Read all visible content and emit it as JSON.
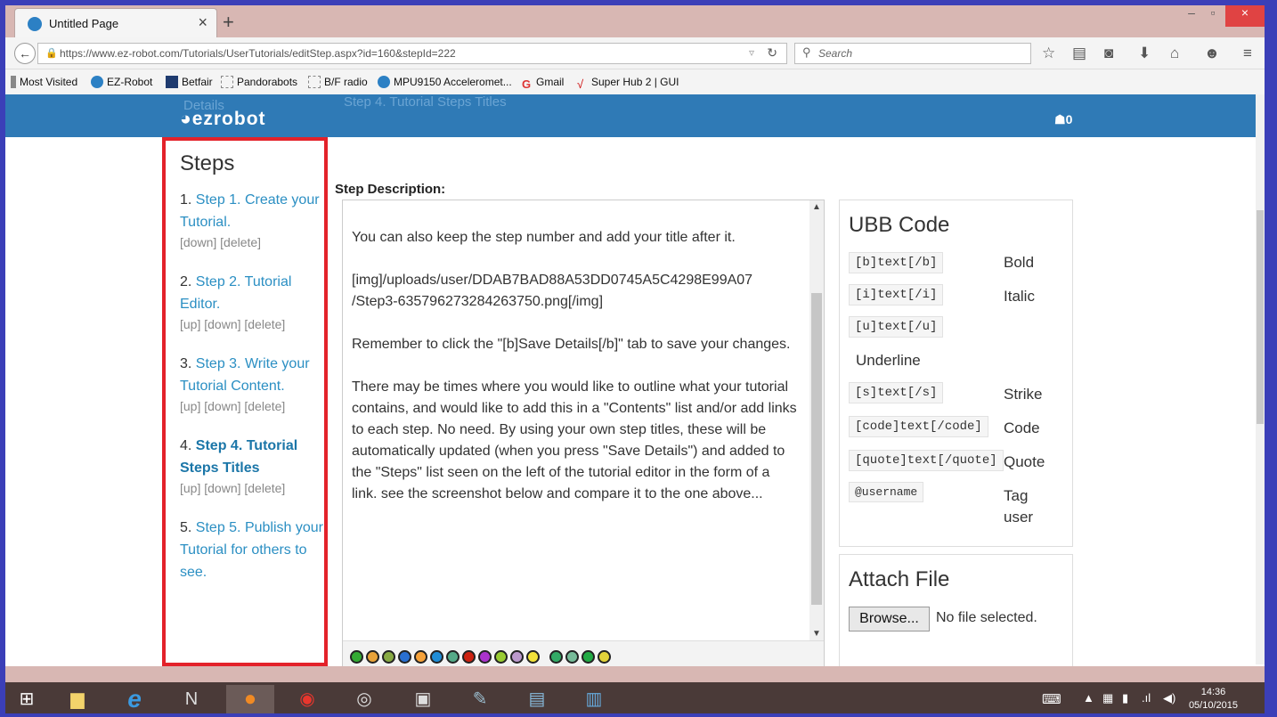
{
  "browser": {
    "tab_title": "Untitled Page",
    "url": "https://www.ez-robot.com/Tutorials/UserTutorials/editStep.aspx?id=160&stepId=222",
    "search_placeholder": "Search",
    "bookmarks": [
      "Most Visited",
      "EZ-Robot",
      "Betfair",
      "Pandorabots",
      "B/F radio",
      "MPU9150 Acceleromet...",
      "Gmail",
      "Super Hub 2 | GUI"
    ]
  },
  "site": {
    "logo": "ezrobot",
    "cart_count": "0",
    "ghost_title": "Step 4. Tutorial Steps Titles",
    "ghost_details": "Details"
  },
  "steps": {
    "heading": "Steps",
    "items": [
      {
        "num": "1.",
        "title": "Step 1. Create your Tutorial.",
        "ctrls": "[down] [delete]"
      },
      {
        "num": "2.",
        "title": "Step 2. Tutorial Editor.",
        "ctrls": "[up] [down] [delete]"
      },
      {
        "num": "3.",
        "title": "Step 3. Write your Tutorial Content.",
        "ctrls": "[up] [down] [delete]"
      },
      {
        "num": "4.",
        "title": "Step 4. Tutorial Steps Titles",
        "ctrls": "[up] [down] [delete]"
      },
      {
        "num": "5.",
        "title": "Step 5. Publish your Tutorial for others to see.",
        "ctrls": ""
      }
    ]
  },
  "editor": {
    "label": "Step Description:",
    "text": "You can also keep the step number and add your title after it.\n\n[img]/uploads/user/DDAB7BAD88A53DD0745A5C4298E99A07\n/Step3-635796273284263750.png[/img]\n\nRemember to click the \"[b]Save Details[/b]\" tab to save your changes.\n\nThere may be times where you would like to outline what your tutorial contains, and would like to add this in a \"Contents\" list and/or add links to each step. No need. By using your own step titles, these will be automatically updated (when you press \"Save Details\") and added to the \"Steps\" list seen on the left of the tutorial editor in the form of a link. see the screenshot below and compare it to the one above..."
  },
  "ubb": {
    "heading": "UBB Code",
    "codes": [
      {
        "code": "[b]text[/b]",
        "label": "Bold"
      },
      {
        "code": "[i]text[/i]",
        "label": "Italic"
      },
      {
        "code": "[u]text[/u]",
        "label": "Underline"
      },
      {
        "code": "[s]text[/s]",
        "label": "Strike"
      },
      {
        "code": "[code]text[/code]",
        "label": "Code"
      },
      {
        "code": "[quote]text[/quote]",
        "label": "Quote"
      },
      {
        "code": "@username",
        "label": "Tag user"
      }
    ]
  },
  "attach": {
    "heading": "Attach File",
    "browse_label": "Browse...",
    "status": "No file selected."
  },
  "taskbar": {
    "time": "14:36",
    "date": "05/10/2015"
  },
  "colors": {
    "brand_blue": "#2f7ab6",
    "highlight_red": "#e3222a",
    "link": "#2b8fc3"
  }
}
